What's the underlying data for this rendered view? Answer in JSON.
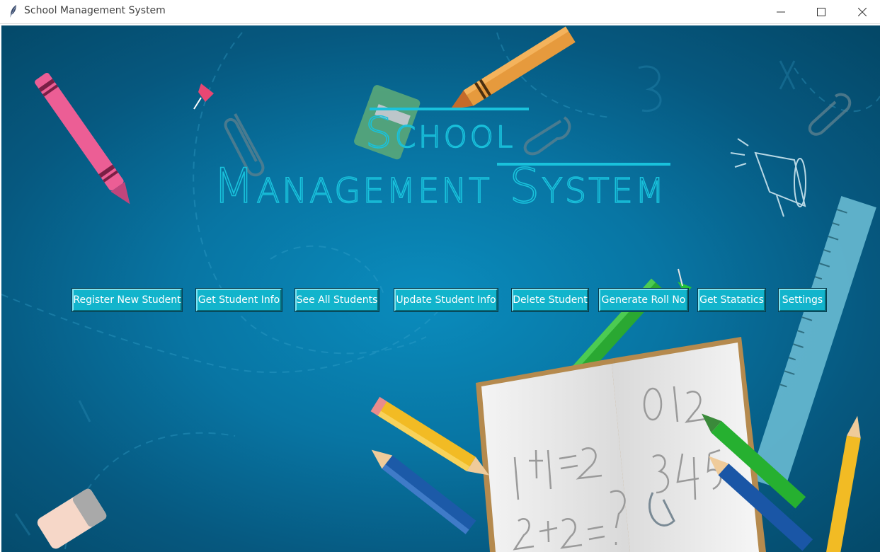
{
  "window": {
    "title": "School Management System",
    "controls": [
      "minimize",
      "maximize",
      "close"
    ]
  },
  "banner": {
    "line1": "School",
    "line2": "Management System",
    "color": "#19c2dc"
  },
  "nav_buttons": [
    {
      "label": "Register New Student"
    },
    {
      "label": "Get Student Info"
    },
    {
      "label": "See All Students"
    },
    {
      "label": "Update Student Info"
    },
    {
      "label": "Delete Student"
    },
    {
      "label": "Generate Roll No"
    },
    {
      "label": "Get Statatics"
    },
    {
      "label": "Settings"
    }
  ],
  "notebook": {
    "left_page": [
      "1+1=2",
      "2+2=?"
    ],
    "right_page": [
      "0 1 2",
      "3 4 5"
    ]
  },
  "colors": {
    "background": "#0875a3",
    "button": "#12b4cc",
    "button_text": "#ffffff"
  }
}
